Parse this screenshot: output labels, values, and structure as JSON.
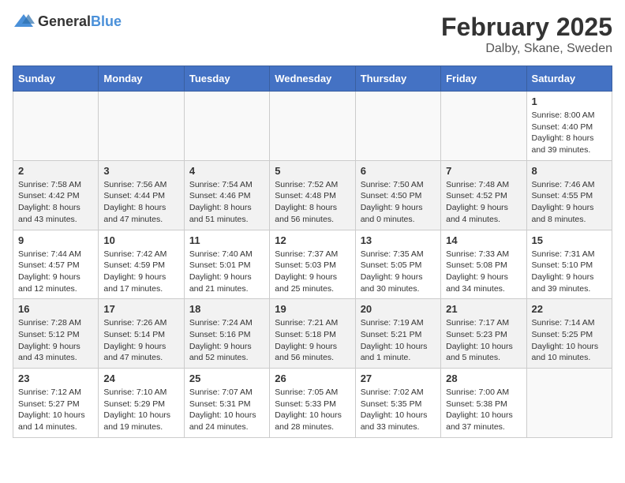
{
  "header": {
    "logo_general": "General",
    "logo_blue": "Blue",
    "month": "February 2025",
    "location": "Dalby, Skane, Sweden"
  },
  "weekdays": [
    "Sunday",
    "Monday",
    "Tuesday",
    "Wednesday",
    "Thursday",
    "Friday",
    "Saturday"
  ],
  "weeks": [
    {
      "shaded": false,
      "days": [
        {
          "empty": true
        },
        {
          "empty": true
        },
        {
          "empty": true
        },
        {
          "empty": true
        },
        {
          "empty": true
        },
        {
          "empty": true
        },
        {
          "date": "1",
          "info": "Sunrise: 8:00 AM\nSunset: 4:40 PM\nDaylight: 8 hours and 39 minutes."
        }
      ]
    },
    {
      "shaded": true,
      "days": [
        {
          "date": "2",
          "info": "Sunrise: 7:58 AM\nSunset: 4:42 PM\nDaylight: 8 hours and 43 minutes."
        },
        {
          "date": "3",
          "info": "Sunrise: 7:56 AM\nSunset: 4:44 PM\nDaylight: 8 hours and 47 minutes."
        },
        {
          "date": "4",
          "info": "Sunrise: 7:54 AM\nSunset: 4:46 PM\nDaylight: 8 hours and 51 minutes."
        },
        {
          "date": "5",
          "info": "Sunrise: 7:52 AM\nSunset: 4:48 PM\nDaylight: 8 hours and 56 minutes."
        },
        {
          "date": "6",
          "info": "Sunrise: 7:50 AM\nSunset: 4:50 PM\nDaylight: 9 hours and 0 minutes."
        },
        {
          "date": "7",
          "info": "Sunrise: 7:48 AM\nSunset: 4:52 PM\nDaylight: 9 hours and 4 minutes."
        },
        {
          "date": "8",
          "info": "Sunrise: 7:46 AM\nSunset: 4:55 PM\nDaylight: 9 hours and 8 minutes."
        }
      ]
    },
    {
      "shaded": false,
      "days": [
        {
          "date": "9",
          "info": "Sunrise: 7:44 AM\nSunset: 4:57 PM\nDaylight: 9 hours and 12 minutes."
        },
        {
          "date": "10",
          "info": "Sunrise: 7:42 AM\nSunset: 4:59 PM\nDaylight: 9 hours and 17 minutes."
        },
        {
          "date": "11",
          "info": "Sunrise: 7:40 AM\nSunset: 5:01 PM\nDaylight: 9 hours and 21 minutes."
        },
        {
          "date": "12",
          "info": "Sunrise: 7:37 AM\nSunset: 5:03 PM\nDaylight: 9 hours and 25 minutes."
        },
        {
          "date": "13",
          "info": "Sunrise: 7:35 AM\nSunset: 5:05 PM\nDaylight: 9 hours and 30 minutes."
        },
        {
          "date": "14",
          "info": "Sunrise: 7:33 AM\nSunset: 5:08 PM\nDaylight: 9 hours and 34 minutes."
        },
        {
          "date": "15",
          "info": "Sunrise: 7:31 AM\nSunset: 5:10 PM\nDaylight: 9 hours and 39 minutes."
        }
      ]
    },
    {
      "shaded": true,
      "days": [
        {
          "date": "16",
          "info": "Sunrise: 7:28 AM\nSunset: 5:12 PM\nDaylight: 9 hours and 43 minutes."
        },
        {
          "date": "17",
          "info": "Sunrise: 7:26 AM\nSunset: 5:14 PM\nDaylight: 9 hours and 47 minutes."
        },
        {
          "date": "18",
          "info": "Sunrise: 7:24 AM\nSunset: 5:16 PM\nDaylight: 9 hours and 52 minutes."
        },
        {
          "date": "19",
          "info": "Sunrise: 7:21 AM\nSunset: 5:18 PM\nDaylight: 9 hours and 56 minutes."
        },
        {
          "date": "20",
          "info": "Sunrise: 7:19 AM\nSunset: 5:21 PM\nDaylight: 10 hours and 1 minute."
        },
        {
          "date": "21",
          "info": "Sunrise: 7:17 AM\nSunset: 5:23 PM\nDaylight: 10 hours and 5 minutes."
        },
        {
          "date": "22",
          "info": "Sunrise: 7:14 AM\nSunset: 5:25 PM\nDaylight: 10 hours and 10 minutes."
        }
      ]
    },
    {
      "shaded": false,
      "days": [
        {
          "date": "23",
          "info": "Sunrise: 7:12 AM\nSunset: 5:27 PM\nDaylight: 10 hours and 14 minutes."
        },
        {
          "date": "24",
          "info": "Sunrise: 7:10 AM\nSunset: 5:29 PM\nDaylight: 10 hours and 19 minutes."
        },
        {
          "date": "25",
          "info": "Sunrise: 7:07 AM\nSunset: 5:31 PM\nDaylight: 10 hours and 24 minutes."
        },
        {
          "date": "26",
          "info": "Sunrise: 7:05 AM\nSunset: 5:33 PM\nDaylight: 10 hours and 28 minutes."
        },
        {
          "date": "27",
          "info": "Sunrise: 7:02 AM\nSunset: 5:35 PM\nDaylight: 10 hours and 33 minutes."
        },
        {
          "date": "28",
          "info": "Sunrise: 7:00 AM\nSunset: 5:38 PM\nDaylight: 10 hours and 37 minutes."
        },
        {
          "empty": true
        }
      ]
    }
  ]
}
